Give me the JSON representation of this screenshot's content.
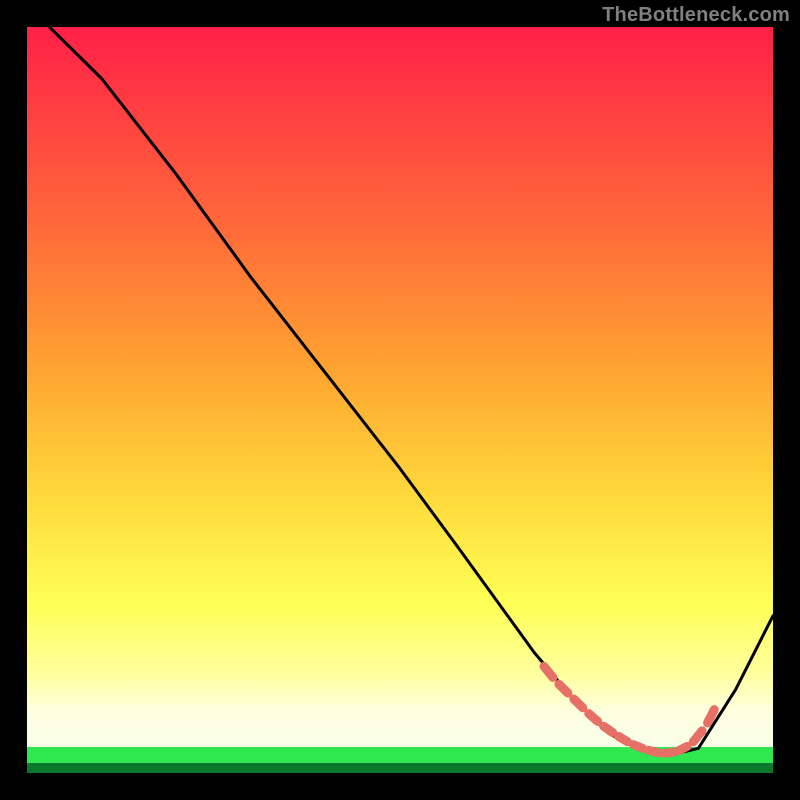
{
  "watermark": "TheBottleneck.com",
  "colors": {
    "black": "#000000",
    "grad_top": "#ff2047",
    "grad_mid1": "#ff8a2a",
    "grad_mid2": "#ffd93b",
    "grad_mid3": "#ffff66",
    "grad_low": "#ffffb0",
    "grad_green": "#2fe84f",
    "curve": "#000000",
    "dash": "#e77066"
  },
  "chart_data": {
    "type": "line",
    "title": "",
    "xlabel": "",
    "ylabel": "",
    "xlim": [
      0,
      100
    ],
    "ylim": [
      0,
      100
    ],
    "grid": false,
    "series": [
      {
        "name": "bottleneck-curve",
        "x": [
          3,
          10,
          20,
          30,
          40,
          50,
          58,
          63,
          68,
          73,
          78,
          82,
          86,
          90,
          95,
          100
        ],
        "y": [
          100,
          93,
          80,
          66,
          53,
          40,
          29,
          22,
          15,
          9,
          4,
          2,
          1,
          2,
          10,
          20
        ]
      }
    ],
    "annotations": [
      {
        "name": "optimal-dash",
        "style": "dashed",
        "x": [
          69,
          71,
          73,
          75,
          77,
          79,
          81,
          83,
          85,
          87,
          89,
          91,
          92.5
        ],
        "y": [
          13.5,
          11,
          9,
          7,
          5.2,
          3.8,
          2.6,
          1.8,
          1.3,
          1.5,
          2.5,
          5,
          8
        ]
      }
    ]
  }
}
